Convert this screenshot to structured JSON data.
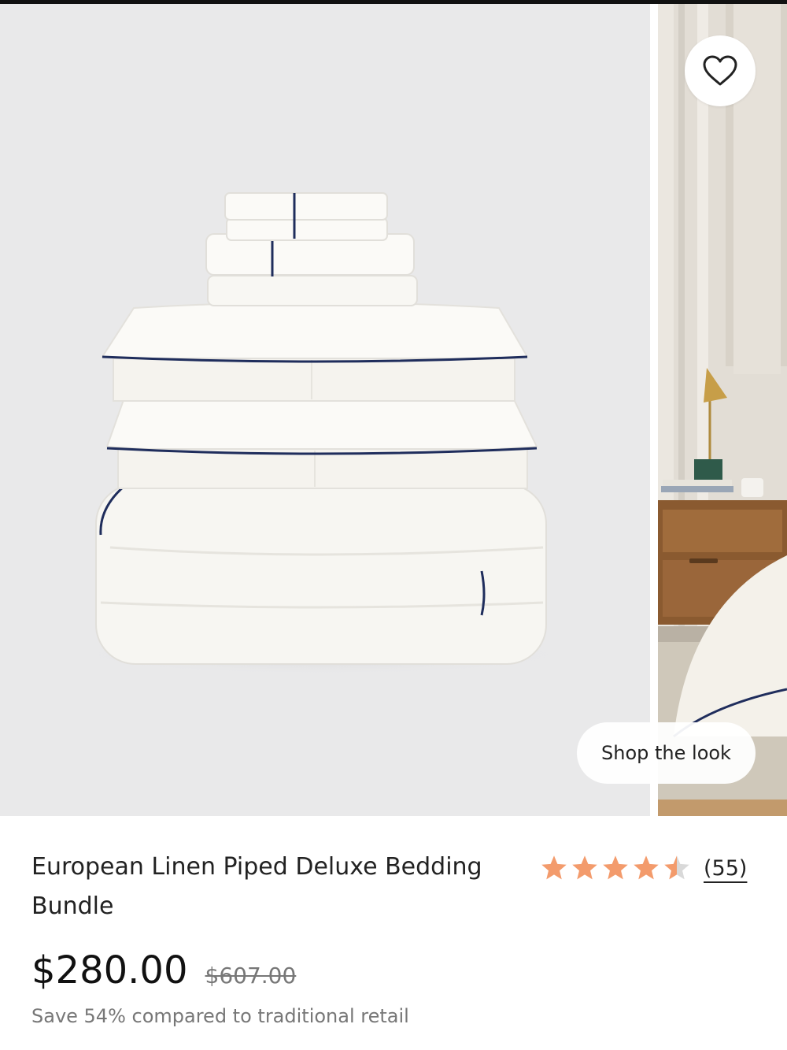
{
  "product": {
    "title": "European Linen Piped Deluxe Bedding Bundle",
    "rating": 4.5,
    "rating_max": 5,
    "review_count": "(55)",
    "price": "$280.00",
    "compare_price": "$607.00",
    "savings_text": "Save 54% compared to traditional retail"
  },
  "gallery": {
    "shop_the_look_label": "Shop the look",
    "favorite_icon": "heart-outline-icon"
  },
  "colors": {
    "star": "#f39b6c",
    "star_empty": "#d9d9d9",
    "piping": "#1f2d5c",
    "image_background": "#e9e9ea"
  }
}
